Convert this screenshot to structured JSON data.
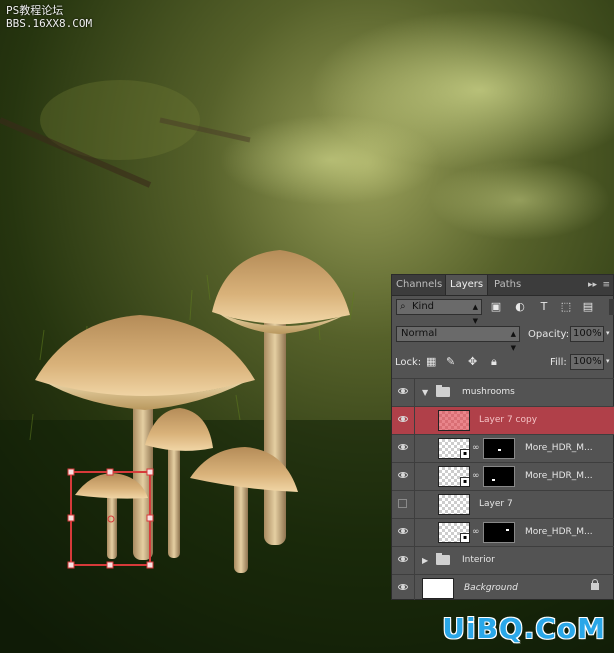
{
  "watermark_top": {
    "line1": "PS教程论坛",
    "line2": "BBS.16XX8.COM"
  },
  "watermark_bottom": "UiBQ.CoM",
  "panel": {
    "tabs": [
      "Channels",
      "Layers",
      "Paths"
    ],
    "active_tab": "Layers",
    "tab_arrows": "▸▸",
    "filter": {
      "kind_label": "Kind",
      "search_symbol": "⌕"
    },
    "blend_mode": "Normal",
    "opacity_label": "Opacity:",
    "opacity_value": "100%",
    "lock_label": "Lock:",
    "fill_label": "Fill:",
    "fill_value": "100%",
    "layers": [
      {
        "name": "mushrooms",
        "type": "group",
        "expanded": true
      },
      {
        "name": "Layer 7 copy",
        "type": "pixel",
        "selected": true
      },
      {
        "name": "More_HDR_M...",
        "type": "smart-mask"
      },
      {
        "name": "More_HDR_M...",
        "type": "smart-mask"
      },
      {
        "name": "Layer 7",
        "type": "pixel",
        "hidden": true
      },
      {
        "name": "More_HDR_M...",
        "type": "smart-mask"
      },
      {
        "name": "Interior",
        "type": "group",
        "expanded": false
      },
      {
        "name": "Background",
        "type": "background",
        "locked": true
      }
    ]
  },
  "colors": {
    "selection_box": "#d63a3a",
    "panel_bg": "#535353",
    "selected_row": "#b04049",
    "watermark_blue": "#2aa7e8"
  }
}
